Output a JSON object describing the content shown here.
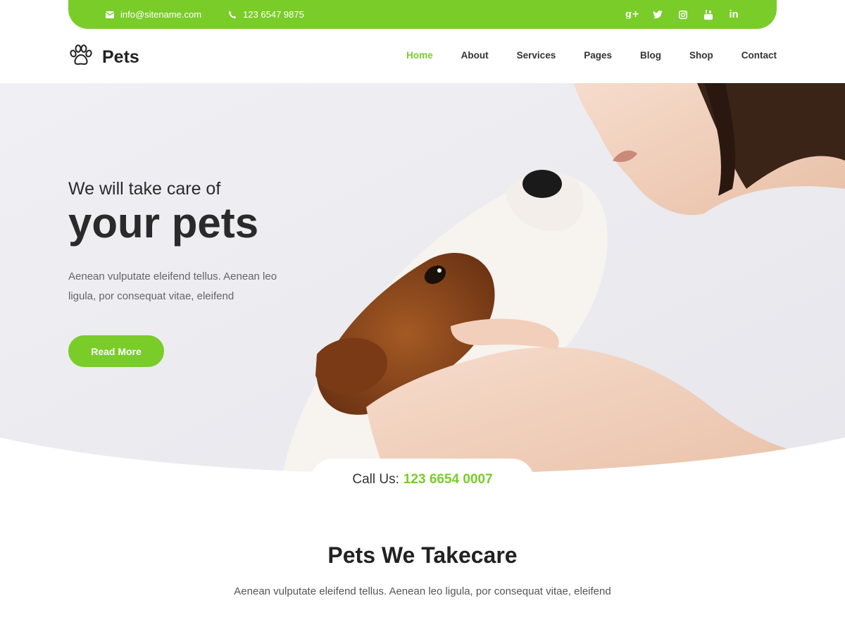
{
  "topbar": {
    "email": "info@sitename.com",
    "phone": "123 6547 9875",
    "social_icons": [
      "google-plus-icon",
      "twitter-icon",
      "instagram-icon",
      "youtube-icon",
      "linkedin-icon"
    ],
    "google_plus_glyph": "g+",
    "linkedin_glyph": "in"
  },
  "brand": {
    "name": "Pets",
    "accent": "#7acc29"
  },
  "nav": {
    "items": [
      "Home",
      "About",
      "Services",
      "Pages",
      "Blog",
      "Shop",
      "Contact"
    ],
    "active": "Home"
  },
  "hero": {
    "line1": "We will take care of",
    "line2": "your pets",
    "description": "Aenean vulputate eleifend tellus. Aenean leo ligula, por consequat vitae, eleifend",
    "button": "Read More"
  },
  "callus": {
    "label": "Call Us:",
    "number": "123 6654 0007"
  },
  "section": {
    "title": "Pets We Takecare",
    "description": "Aenean vulputate eleifend tellus. Aenean leo ligula, por consequat vitae, eleifend"
  }
}
